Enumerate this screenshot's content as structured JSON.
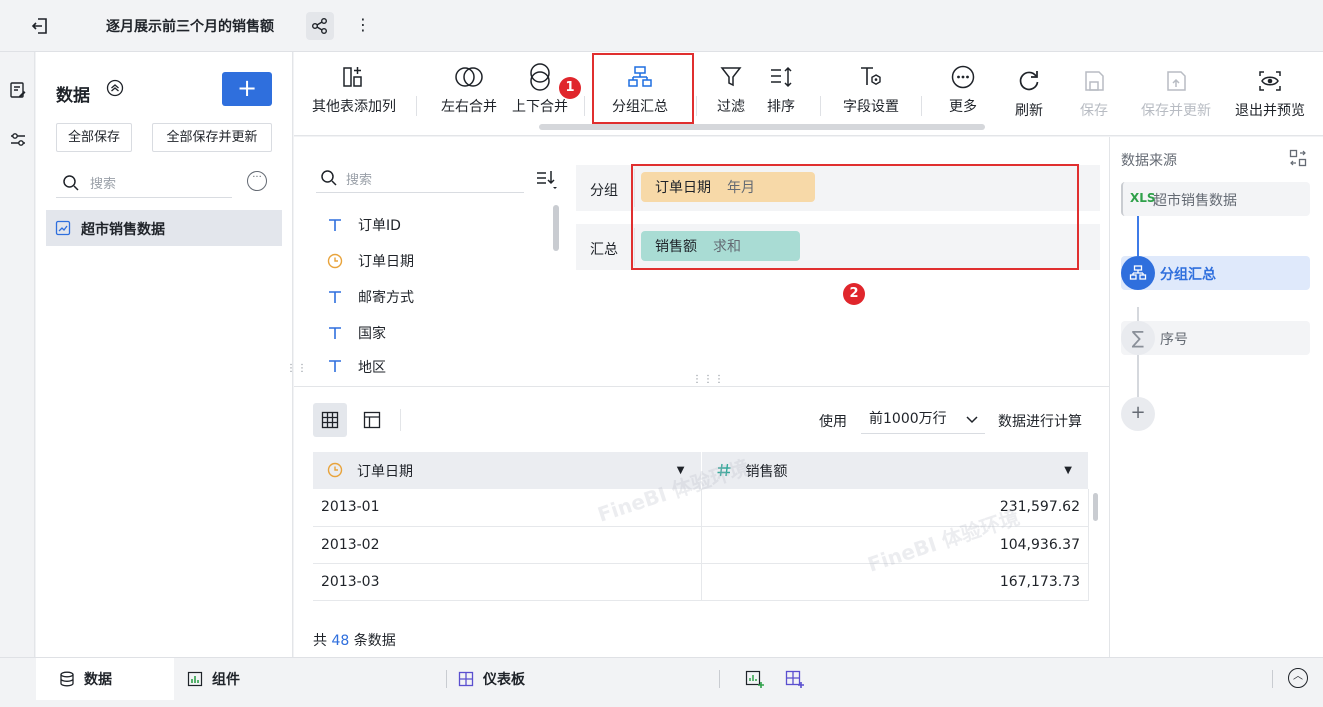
{
  "header": {
    "title": "逐月展示前三个月的销售额"
  },
  "data_panel": {
    "title": "数据",
    "add_label": "+",
    "save_all": "全部保存",
    "save_all_update": "全部保存并更新",
    "search_placeholder": "搜索",
    "datasets": [
      {
        "label": "超市销售数据"
      }
    ]
  },
  "toolbar": {
    "items": [
      {
        "label": "其他表添加列"
      },
      {
        "label": "左右合并"
      },
      {
        "label": "上下合并"
      },
      {
        "label": "分组汇总"
      },
      {
        "label": "过滤"
      },
      {
        "label": "排序"
      },
      {
        "label": "字段设置"
      },
      {
        "label": "更多"
      },
      {
        "label": "刷新"
      },
      {
        "label": "保存"
      },
      {
        "label": "保存并更新"
      },
      {
        "label": "退出并预览"
      }
    ],
    "badge1": "1",
    "badge2": "2"
  },
  "fields": {
    "search_placeholder": "搜索",
    "items": [
      {
        "label": "订单ID",
        "type": "text"
      },
      {
        "label": "订单日期",
        "type": "date"
      },
      {
        "label": "邮寄方式",
        "type": "text"
      },
      {
        "label": "国家",
        "type": "text"
      },
      {
        "label": "地区",
        "type": "text"
      }
    ]
  },
  "group_config": {
    "group_label": "分组",
    "group_field": "订单日期",
    "group_sub": "年月",
    "agg_label": "汇总",
    "agg_field": "销售额",
    "agg_sub": "求和",
    "colors": {
      "group_pill": "#f7d9a8",
      "agg_pill": "#a9dcd4"
    }
  },
  "preview": {
    "use_label": "使用",
    "rows_option": "前1000万行",
    "calc_label": "数据进行计算",
    "columns": [
      {
        "label": "订单日期",
        "icon": "clock-icon"
      },
      {
        "label": "销售额",
        "icon": "hash-icon"
      }
    ],
    "rows": [
      [
        "2013-01",
        "231,597.62"
      ],
      [
        "2013-02",
        "104,936.37"
      ],
      [
        "2013-03",
        "167,173.73"
      ]
    ],
    "count_prefix": "共",
    "count_value": "48",
    "count_suffix": "条数据",
    "watermark": "FineBI 体验环境"
  },
  "flow": {
    "header": "数据来源",
    "nodes": [
      {
        "label": "超市销售数据",
        "tag": "XLS"
      },
      {
        "label": "分组汇总"
      },
      {
        "label": "序号"
      }
    ],
    "add": "+"
  },
  "bottom": {
    "tabs": [
      {
        "label": "数据"
      },
      {
        "label": "组件"
      },
      {
        "label": "仪表板"
      }
    ]
  },
  "colors": {
    "accent": "#2f6fdd",
    "highlight": "#e02f2f"
  }
}
